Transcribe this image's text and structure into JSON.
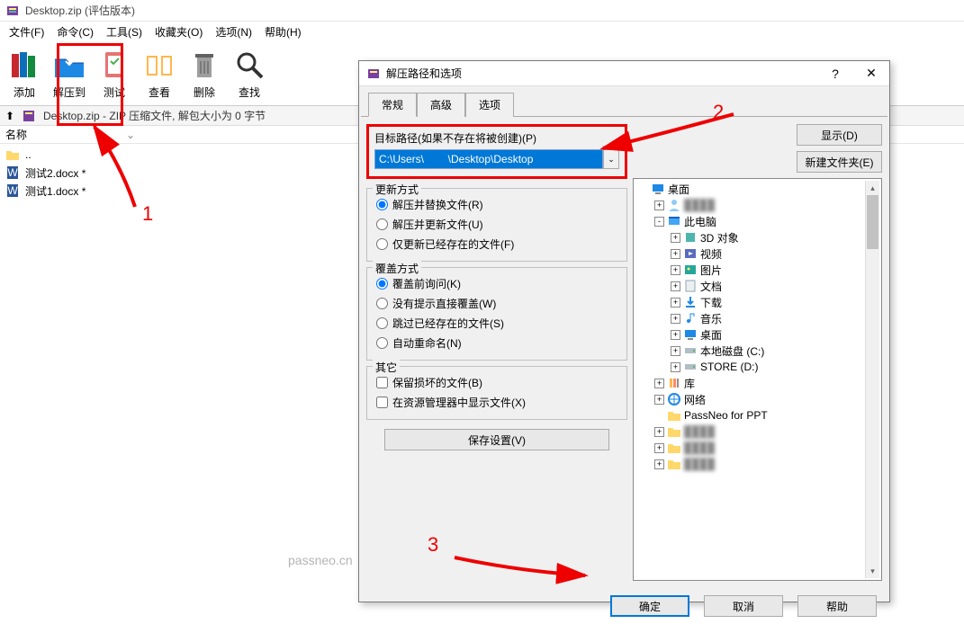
{
  "main": {
    "title": "Desktop.zip (评估版本)",
    "menu": [
      "文件(F)",
      "命令(C)",
      "工具(S)",
      "收藏夹(O)",
      "选项(N)",
      "帮助(H)"
    ],
    "toolbar": [
      "添加",
      "解压到",
      "测试",
      "查看",
      "删除",
      "查找"
    ],
    "path_bar": "Desktop.zip - ZIP 压缩文件, 解包大小为 0 字节",
    "list_header": "名称",
    "files": [
      "..",
      "测试2.docx *",
      "测试1.docx *"
    ]
  },
  "dialog": {
    "title": "解压路径和选项",
    "tabs": [
      "常规",
      "高级",
      "选项"
    ],
    "path_label": "目标路径(如果不存在将被创建)(P)",
    "path_value": "C:\\Users\\        \\Desktop\\Desktop",
    "show_btn": "显示(D)",
    "newfolder_btn": "新建文件夹(E)",
    "update_group": "更新方式",
    "update_opts": [
      "解压并替换文件(R)",
      "解压并更新文件(U)",
      "仅更新已经存在的文件(F)"
    ],
    "overwrite_group": "覆盖方式",
    "overwrite_opts": [
      "覆盖前询问(K)",
      "没有提示直接覆盖(W)",
      "跳过已经存在的文件(S)",
      "自动重命名(N)"
    ],
    "other_group": "其它",
    "other_opts": [
      "保留损坏的文件(B)",
      "在资源管理器中显示文件(X)"
    ],
    "save_settings": "保存设置(V)",
    "tree": [
      {
        "indent": 0,
        "label": "桌面",
        "icon": "desktop",
        "exp": ""
      },
      {
        "indent": 1,
        "label": "",
        "icon": "user",
        "exp": "+",
        "blur": true
      },
      {
        "indent": 1,
        "label": "此电脑",
        "icon": "pc",
        "exp": "-"
      },
      {
        "indent": 2,
        "label": "3D 对象",
        "icon": "3d",
        "exp": "+"
      },
      {
        "indent": 2,
        "label": "视频",
        "icon": "video",
        "exp": "+"
      },
      {
        "indent": 2,
        "label": "图片",
        "icon": "pic",
        "exp": "+"
      },
      {
        "indent": 2,
        "label": "文档",
        "icon": "doc",
        "exp": "+"
      },
      {
        "indent": 2,
        "label": "下载",
        "icon": "dl",
        "exp": "+"
      },
      {
        "indent": 2,
        "label": "音乐",
        "icon": "music",
        "exp": "+"
      },
      {
        "indent": 2,
        "label": "桌面",
        "icon": "desktop",
        "exp": "+"
      },
      {
        "indent": 2,
        "label": "本地磁盘 (C:)",
        "icon": "drive",
        "exp": "+"
      },
      {
        "indent": 2,
        "label": "STORE (D:)",
        "icon": "drive",
        "exp": "+"
      },
      {
        "indent": 1,
        "label": "库",
        "icon": "lib",
        "exp": "+"
      },
      {
        "indent": 1,
        "label": "网络",
        "icon": "net",
        "exp": "+"
      },
      {
        "indent": 1,
        "label": "PassNeo for PPT",
        "icon": "folder",
        "exp": ""
      },
      {
        "indent": 1,
        "label": "",
        "icon": "folder",
        "exp": "+",
        "blur": true
      },
      {
        "indent": 1,
        "label": "",
        "icon": "folder",
        "exp": "+",
        "blur": true
      },
      {
        "indent": 1,
        "label": "",
        "icon": "folder",
        "exp": "+",
        "blur": true
      }
    ],
    "ok": "确定",
    "cancel": "取消",
    "help": "帮助"
  },
  "annotations": {
    "n1": "1",
    "n2": "2",
    "n3": "3"
  },
  "watermark": "passneo.cn"
}
